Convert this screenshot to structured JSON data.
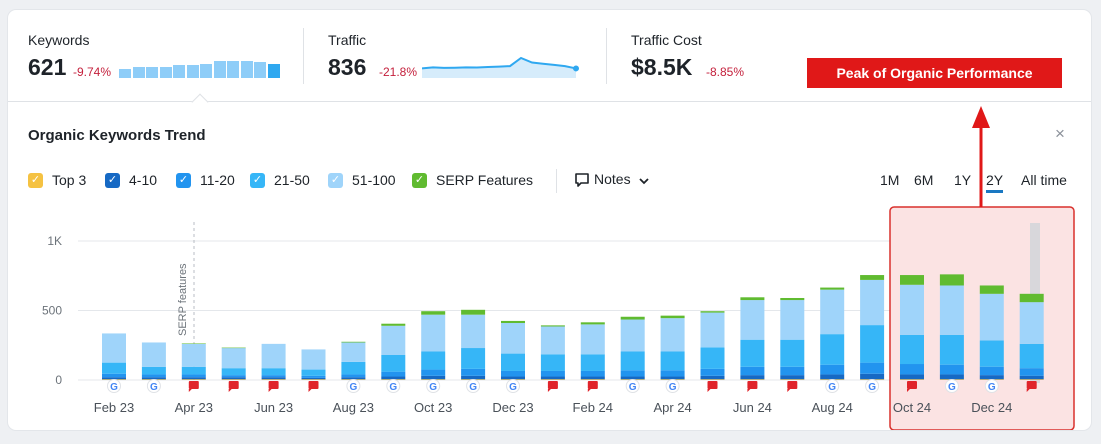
{
  "metrics": [
    {
      "label": "Keywords",
      "value": "621",
      "delta": "-9.74%"
    },
    {
      "label": "Traffic",
      "value": "836",
      "delta": "-21.8%"
    },
    {
      "label": "Traffic Cost",
      "value": "$8.5K",
      "delta": "-8.85%"
    }
  ],
  "keywords_sparkline": [
    0.55,
    0.62,
    0.62,
    0.65,
    0.78,
    0.78,
    0.82,
    1.0,
    1.0,
    1.0,
    0.95,
    0.82
  ],
  "traffic_sparkline": [
    0.42,
    0.48,
    0.45,
    0.46,
    0.48,
    0.47,
    0.5,
    0.52,
    0.55,
    1.0,
    0.75,
    0.68,
    0.62,
    0.55,
    0.42
  ],
  "annotation": {
    "label": "Peak of Organic Performance",
    "color": "#e01818"
  },
  "chart_title": "Organic Keywords Trend",
  "close_icon": "×",
  "legend": [
    {
      "label": "Top 3",
      "color": "#f5c242"
    },
    {
      "label": "4-10",
      "color": "#1669c4"
    },
    {
      "label": "11-20",
      "color": "#2294ef"
    },
    {
      "label": "21-50",
      "color": "#36b6f7"
    },
    {
      "label": "51-100",
      "color": "#9fd4fa"
    },
    {
      "label": "SERP Features",
      "color": "#60bb30"
    }
  ],
  "notes_label": "Notes",
  "periods": [
    {
      "label": "1M",
      "active": false
    },
    {
      "label": "6M",
      "active": false
    },
    {
      "label": "1Y",
      "active": false
    },
    {
      "label": "2Y",
      "active": true
    },
    {
      "label": "All time",
      "active": false
    }
  ],
  "chart_data": {
    "type": "bar",
    "title": "Organic Keywords Trend",
    "ylim": [
      0,
      1000
    ],
    "y_ticks": [
      "0",
      "500",
      "1K"
    ],
    "x_tick_labels": [
      "Feb 23",
      "Apr 23",
      "Jun 23",
      "Aug 23",
      "Oct 23",
      "Dec 23",
      "Feb 24",
      "Apr 24",
      "Jun 24",
      "Aug 24",
      "Oct 24",
      "Dec 24"
    ],
    "vertical_annotation": "SERP features",
    "series_colors": {
      "Top 3": "#f5c242",
      "4-10": "#1669c4",
      "11-20": "#2294ef",
      "21-50": "#36b6f7",
      "51-100": "#9fd4fa",
      "SERP Features": "#60bb30"
    },
    "bars": [
      {
        "top3": 5,
        "t4_10": 15,
        "t11_20": 25,
        "t21_50": 80,
        "t51_100": 210,
        "serp": 0,
        "marker": "google"
      },
      {
        "top3": 5,
        "t4_10": 15,
        "t11_20": 20,
        "t21_50": 55,
        "t51_100": 175,
        "serp": 0,
        "marker": "google"
      },
      {
        "top3": 5,
        "t4_10": 15,
        "t11_20": 20,
        "t21_50": 55,
        "t51_100": 165,
        "serp": 3,
        "marker": "flag"
      },
      {
        "top3": 5,
        "t4_10": 15,
        "t11_20": 15,
        "t21_50": 50,
        "t51_100": 145,
        "serp": 3,
        "marker": "flag"
      },
      {
        "top3": 5,
        "t4_10": 15,
        "t11_20": 15,
        "t21_50": 50,
        "t51_100": 175,
        "serp": 0,
        "marker": "flag"
      },
      {
        "top3": 5,
        "t4_10": 10,
        "t11_20": 15,
        "t21_50": 45,
        "t51_100": 145,
        "serp": 0,
        "marker": "flag"
      },
      {
        "top3": 5,
        "t4_10": 15,
        "t11_20": 20,
        "t21_50": 90,
        "t51_100": 140,
        "serp": 5,
        "marker": "google"
      },
      {
        "top3": 5,
        "t4_10": 20,
        "t11_20": 35,
        "t21_50": 120,
        "t51_100": 210,
        "serp": 15,
        "marker": "google"
      },
      {
        "top3": 5,
        "t4_10": 25,
        "t11_20": 45,
        "t21_50": 130,
        "t51_100": 265,
        "serp": 25,
        "marker": "google"
      },
      {
        "top3": 5,
        "t4_10": 25,
        "t11_20": 50,
        "t21_50": 150,
        "t51_100": 240,
        "serp": 35,
        "marker": "google"
      },
      {
        "top3": 5,
        "t4_10": 20,
        "t11_20": 40,
        "t21_50": 125,
        "t51_100": 220,
        "serp": 15,
        "marker": "google"
      },
      {
        "top3": 5,
        "t4_10": 20,
        "t11_20": 40,
        "t21_50": 120,
        "t51_100": 200,
        "serp": 8,
        "marker": "flag"
      },
      {
        "top3": 5,
        "t4_10": 20,
        "t11_20": 40,
        "t21_50": 120,
        "t51_100": 215,
        "serp": 15,
        "marker": "flag"
      },
      {
        "top3": 5,
        "t4_10": 20,
        "t11_20": 45,
        "t21_50": 135,
        "t51_100": 230,
        "serp": 20,
        "marker": "google"
      },
      {
        "top3": 5,
        "t4_10": 20,
        "t11_20": 45,
        "t21_50": 135,
        "t51_100": 240,
        "serp": 18,
        "marker": "google"
      },
      {
        "top3": 5,
        "t4_10": 25,
        "t11_20": 50,
        "t21_50": 155,
        "t51_100": 250,
        "serp": 10,
        "marker": "flag"
      },
      {
        "top3": 5,
        "t4_10": 30,
        "t11_20": 60,
        "t21_50": 195,
        "t51_100": 285,
        "serp": 20,
        "marker": "flag"
      },
      {
        "top3": 5,
        "t4_10": 30,
        "t11_20": 60,
        "t21_50": 195,
        "t51_100": 285,
        "serp": 15,
        "marker": "flag"
      },
      {
        "top3": 5,
        "t4_10": 35,
        "t11_20": 70,
        "t21_50": 220,
        "t51_100": 320,
        "serp": 15,
        "marker": "google"
      },
      {
        "top3": 5,
        "t4_10": 40,
        "t11_20": 80,
        "t21_50": 270,
        "t51_100": 325,
        "serp": 35,
        "marker": "google"
      },
      {
        "top3": 5,
        "t4_10": 35,
        "t11_20": 75,
        "t21_50": 210,
        "t51_100": 360,
        "serp": 70,
        "marker": "flag"
      },
      {
        "top3": 5,
        "t4_10": 35,
        "t11_20": 70,
        "t21_50": 215,
        "t51_100": 355,
        "serp": 80,
        "marker": "google"
      },
      {
        "top3": 5,
        "t4_10": 30,
        "t11_20": 60,
        "t21_50": 190,
        "t51_100": 335,
        "serp": 60,
        "marker": "google"
      },
      {
        "top3": 5,
        "t4_10": 25,
        "t11_20": 55,
        "t21_50": 175,
        "t51_100": 300,
        "serp": 60,
        "marker": "flag"
      }
    ]
  }
}
